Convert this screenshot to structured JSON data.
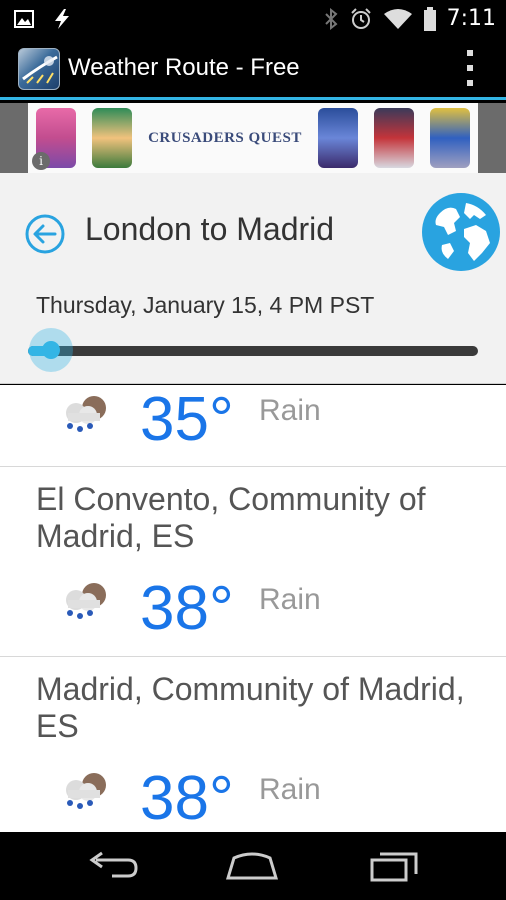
{
  "status_bar": {
    "time": "7:11",
    "left_icons": [
      "image-icon",
      "flash-icon"
    ],
    "right_icons": [
      "bluetooth-icon",
      "alarm-icon",
      "wifi-icon",
      "battery-icon"
    ]
  },
  "action_bar": {
    "title": "Weather Route - Free",
    "app_icon": "weather-route-app-icon",
    "menu_icon": "overflow-menu-icon"
  },
  "ad": {
    "text": "CRUSADERS QUEST",
    "info_glyph": "i"
  },
  "route": {
    "title": "London to Madrid",
    "date": "Thursday, January 15, 4 PM PST",
    "slider_fraction": 0.05,
    "accent": "#33b5e5"
  },
  "stops": [
    {
      "location": "",
      "temperature": "35°",
      "condition": "Rain",
      "icon": "rain-cloud-icon"
    },
    {
      "location": "El Convento, Community of Madrid, ES",
      "temperature": "38°",
      "condition": "Rain",
      "icon": "rain-cloud-icon"
    },
    {
      "location": "Madrid, Community of Madrid, ES",
      "temperature": "38°",
      "condition": "Rain",
      "icon": "rain-cloud-icon"
    }
  ],
  "colors": {
    "temperature": "#1a75e8",
    "globe": "#29a3e0",
    "back_arrow": "#29a3e0"
  },
  "nav": [
    "back-icon",
    "home-icon",
    "recent-apps-icon"
  ]
}
